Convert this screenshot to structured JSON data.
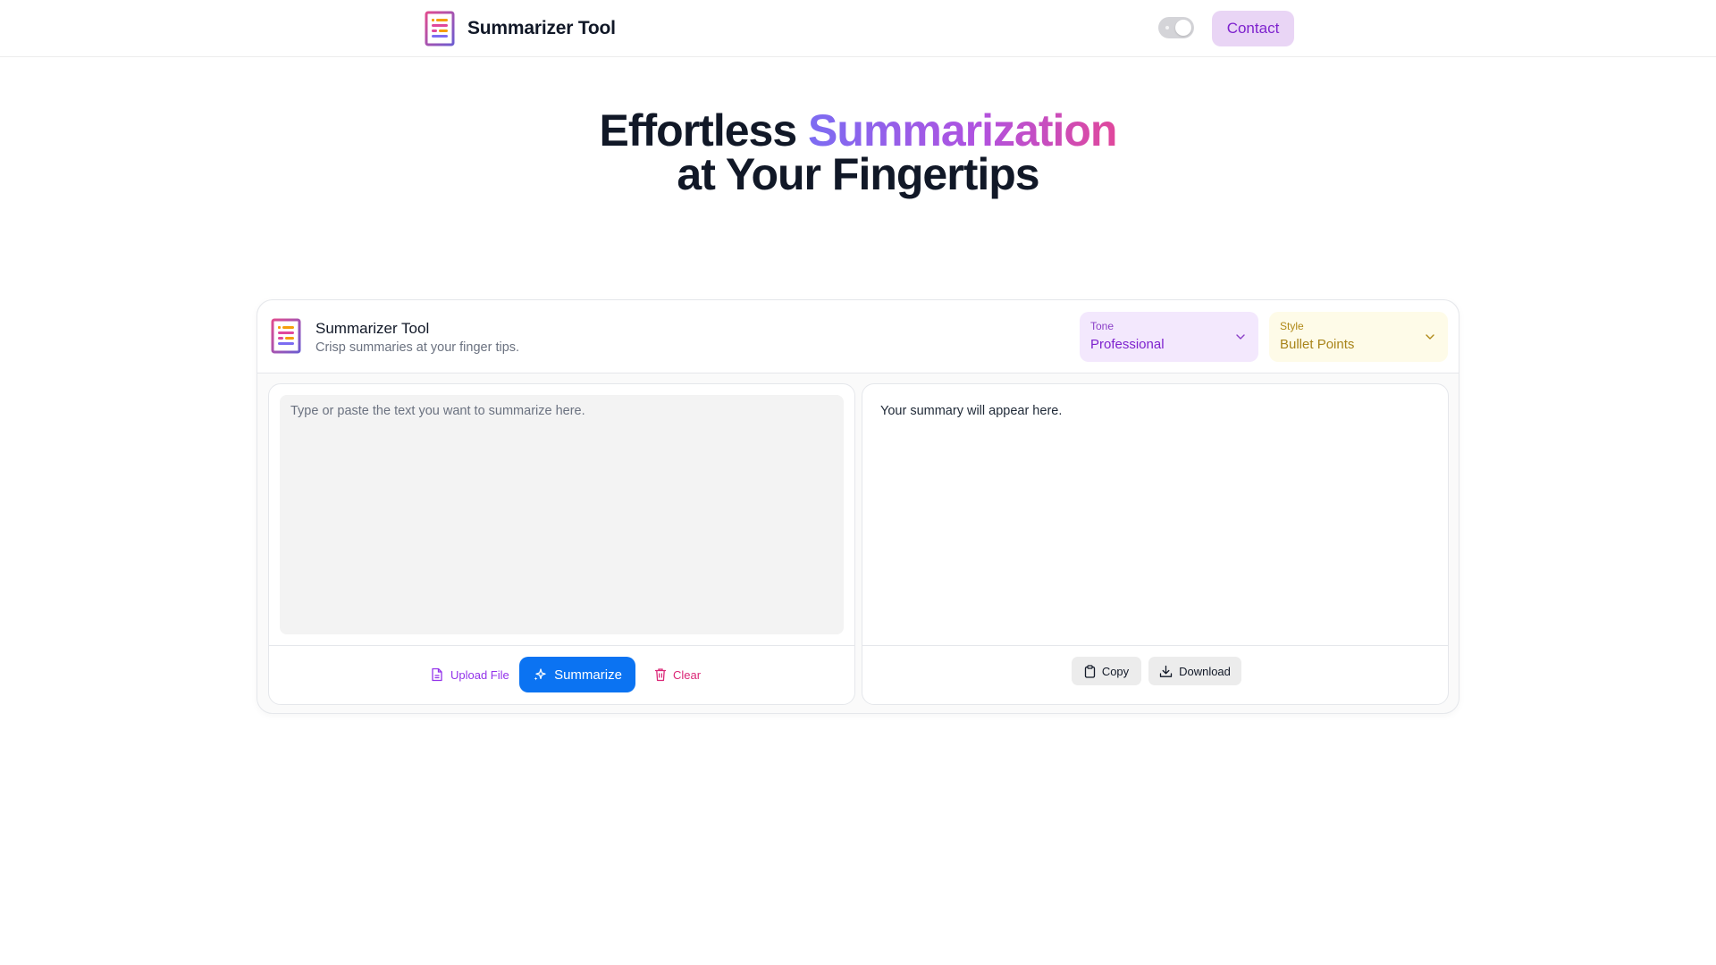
{
  "nav": {
    "brand_title": "Summarizer Tool",
    "contact_label": "Contact",
    "theme_toggle": "on"
  },
  "hero": {
    "line1_prefix": "Effortless ",
    "line1_highlight": "Summarization",
    "line2": "at Your Fingertips"
  },
  "card": {
    "title": "Summarizer Tool",
    "subtitle": "Crisp summaries at your finger tips.",
    "tone": {
      "label": "Tone",
      "value": "Professional"
    },
    "style": {
      "label": "Style",
      "value": "Bullet Points"
    }
  },
  "input": {
    "placeholder": "Type or paste the text you want to summarize here.",
    "value": "",
    "upload_label": "Upload File",
    "summarize_label": "Summarize",
    "clear_label": "Clear"
  },
  "output": {
    "text": "Your summary will appear here.",
    "copy_label": "Copy",
    "download_label": "Download"
  },
  "colors": {
    "accent_blue": "#0b73f2",
    "purple": "#7e22ce",
    "pink": "#db2777",
    "tone_bg": "#f3e8fd",
    "style_bg": "#fefbe8"
  },
  "icons": [
    "document-lines-icon",
    "chevron-down-icon",
    "file-icon",
    "sparkles-icon",
    "trash-icon",
    "clipboard-icon",
    "download-icon"
  ]
}
